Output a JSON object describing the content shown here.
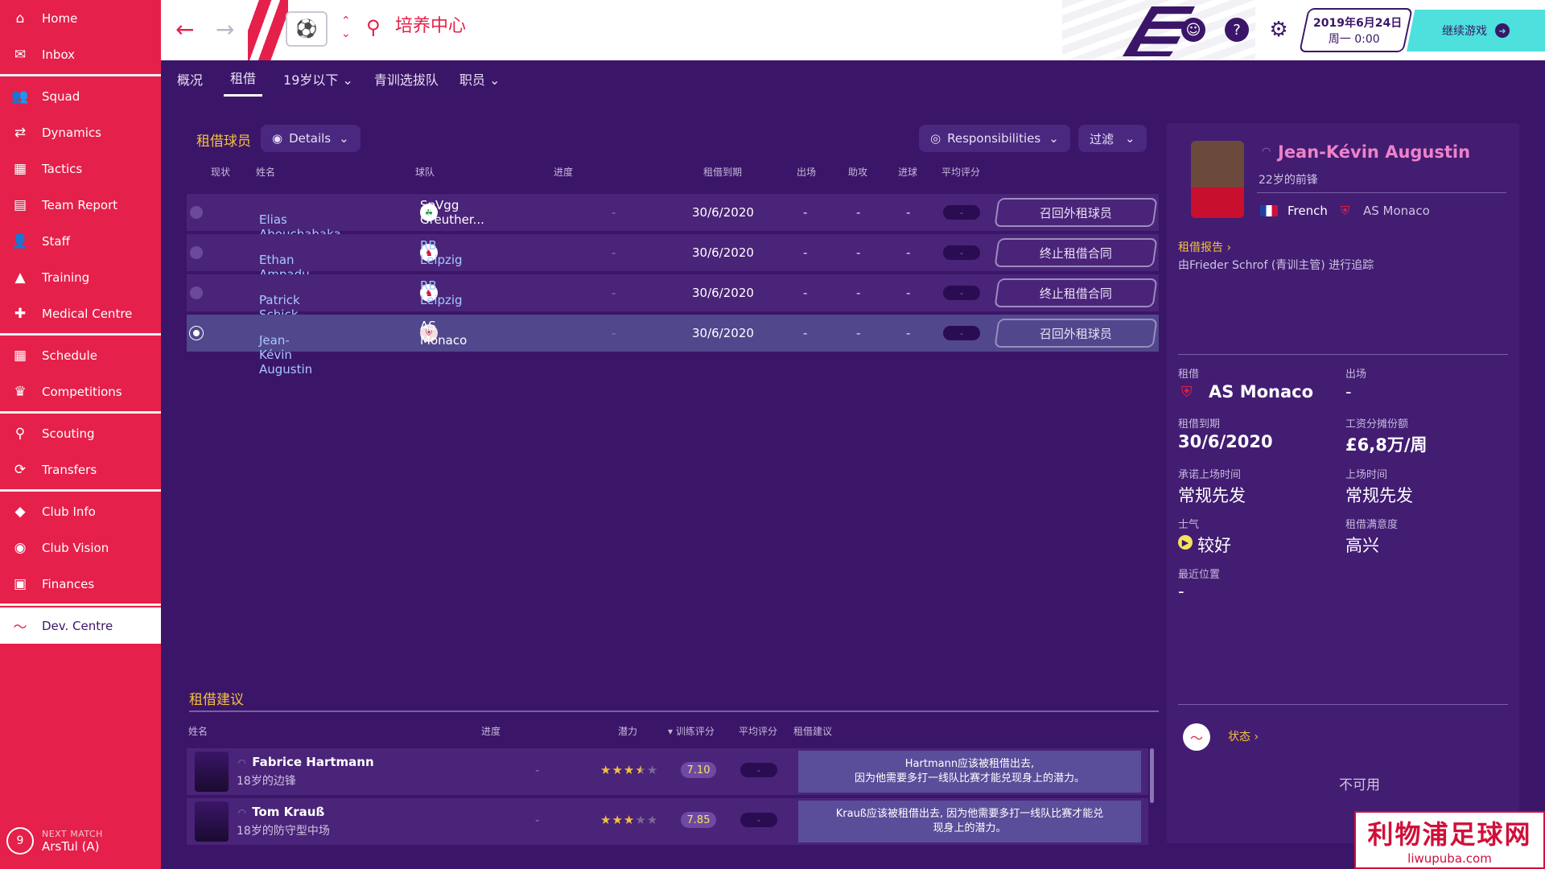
{
  "sidebar": {
    "items": [
      {
        "label": "Home",
        "icon": "home-icon",
        "glyph": "⌂"
      },
      {
        "label": "Inbox",
        "icon": "inbox-icon",
        "glyph": "✉"
      },
      {
        "label": "Squad",
        "icon": "squad-icon",
        "glyph": "👥"
      },
      {
        "label": "Dynamics",
        "icon": "dynamics-icon",
        "glyph": "⇄"
      },
      {
        "label": "Tactics",
        "icon": "tactics-icon",
        "glyph": "▦"
      },
      {
        "label": "Team Report",
        "icon": "report-icon",
        "glyph": "▤"
      },
      {
        "label": "Staff",
        "icon": "staff-icon",
        "glyph": "👤"
      },
      {
        "label": "Training",
        "icon": "training-icon",
        "glyph": "▲"
      },
      {
        "label": "Medical Centre",
        "icon": "medical-icon",
        "glyph": "✚"
      },
      {
        "label": "Schedule",
        "icon": "schedule-icon",
        "glyph": "▦"
      },
      {
        "label": "Competitions",
        "icon": "trophy-icon",
        "glyph": "♛"
      },
      {
        "label": "Scouting",
        "icon": "scouting-icon",
        "glyph": "⚲"
      },
      {
        "label": "Transfers",
        "icon": "transfers-icon",
        "glyph": "⟳"
      },
      {
        "label": "Club Info",
        "icon": "shield-icon",
        "glyph": "◆"
      },
      {
        "label": "Club Vision",
        "icon": "vision-icon",
        "glyph": "◉"
      },
      {
        "label": "Finances",
        "icon": "finances-icon",
        "glyph": "▣"
      },
      {
        "label": "Dev. Centre",
        "icon": "dev-centre-icon",
        "glyph": "〜"
      }
    ],
    "next_match_label": "NEXT MATCH",
    "next_match_text": "ArsTul (A)",
    "next_match_num": "9"
  },
  "topbar": {
    "title": "培养中心",
    "date_line1": "2019年6月24日",
    "date_line2": "周一 0:00",
    "continue_label": "继续游戏"
  },
  "subnav": {
    "tabs": [
      "概况",
      "租借",
      "19岁以下 ⌄",
      "青训选拔队",
      "职员 ⌄"
    ]
  },
  "loans": {
    "title": "租借球员",
    "details_btn": "Details",
    "responsibilities_btn": "Responsibilities",
    "filter_btn": "过滤",
    "headers": [
      "现状",
      "姓名",
      "球队",
      "进度",
      "租借到期",
      "出场",
      "助攻",
      "进球",
      "平均评分"
    ],
    "rows": [
      {
        "name": "Elias Abouchabaka",
        "club": "SpVgg Greuther...",
        "progress": "-",
        "expiry": "30/6/2020",
        "apps": "-",
        "assists": "-",
        "goals": "-",
        "rating": "-",
        "action": "召回外租球员"
      },
      {
        "name": "Ethan Ampadu",
        "club": "RB Leipzig",
        "progress": "-",
        "expiry": "30/6/2020",
        "apps": "-",
        "assists": "-",
        "goals": "-",
        "rating": "-",
        "action": "终止租借合同"
      },
      {
        "name": "Patrick Schick",
        "club": "RB Leipzig",
        "progress": "-",
        "expiry": "30/6/2020",
        "apps": "-",
        "assists": "-",
        "goals": "-",
        "rating": "-",
        "action": "终止租借合同"
      },
      {
        "name": "Jean-Kévin Augustin",
        "club": "AS Monaco",
        "progress": "-",
        "expiry": "30/6/2020",
        "apps": "-",
        "assists": "-",
        "goals": "-",
        "rating": "-",
        "action": "召回外租球员"
      }
    ]
  },
  "suggestions": {
    "title": "租借建议",
    "headers": [
      "姓名",
      "进度",
      "潜力",
      "▾ 训练评分",
      "平均评分",
      "租借建议"
    ],
    "rows": [
      {
        "name": "Fabrice Hartmann",
        "sub": "18岁的边锋",
        "progress": "-",
        "stars": 3.5,
        "ca": "7.10",
        "rating": "-",
        "advice_1": "Hartmann应该被租借出去,",
        "advice_2": "因为他需要多打一线队比赛才能兑现身上的潜力。"
      },
      {
        "name": "Tom Krauß",
        "sub": "18岁的防守型中场",
        "progress": "-",
        "stars": 3,
        "ca": "7.85",
        "rating": "-",
        "advice_1": "Krauß应该被租借出去, 因为他需要多打一线队比赛才能兑",
        "advice_2": "现身上的潜力。"
      }
    ]
  },
  "profile": {
    "name": "Jean-Kévin Augustin",
    "sub": "22岁的前锋",
    "nationality": "French",
    "club": "AS Monaco",
    "report_link": "租借报告",
    "tracking": "由Frieder Schrof (青训主管) 进行追踪",
    "loan_label": "租借",
    "loan_club": "AS Monaco",
    "apps_label": "出场",
    "apps_value": "-",
    "expiry_label": "租借到期",
    "expiry_value": "30/6/2020",
    "wage_label": "工资分摊份额",
    "wage_value": "£6,8万/周",
    "promised_label": "承诺上场时间",
    "promised_value": "常规先发",
    "playing_label": "上场时间",
    "playing_value": "常规先发",
    "morale_label": "士气",
    "morale_value": "较好",
    "satisfaction_label": "租借满意度",
    "satisfaction_value": "高兴",
    "position_label": "最近位置",
    "position_value": "-",
    "status_link": "状态",
    "unavailable": "不可用"
  },
  "watermark": {
    "line1": "利物浦足球网",
    "line2": "liwupuba.com"
  }
}
